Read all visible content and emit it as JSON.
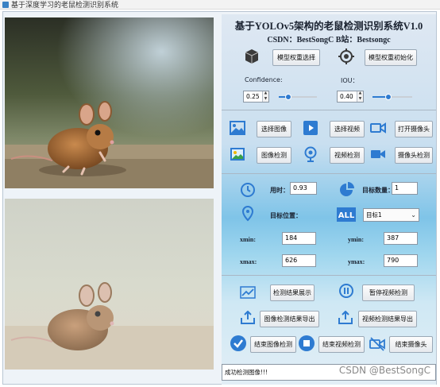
{
  "window": {
    "title": "基于深度学习的老鼠检测识别系统"
  },
  "header": {
    "system_title": "基于YOLOv5架构的老鼠检测识别系统V1.0",
    "csdn_line": "CSDN：BestSongC  B站：Bestsongc"
  },
  "model": {
    "select_label": "模型权重选择",
    "init_label": "模型权重初始化"
  },
  "params": {
    "confidence_label": "Confidence:",
    "confidence_value": "0.25",
    "confidence_level": 0.25,
    "iou_label": "IOU：",
    "iou_value": "0.40",
    "iou_level": 0.4
  },
  "actions": {
    "select_image": "选择图像",
    "select_video": "选择视频",
    "open_camera": "打开摄像头",
    "image_detect": "图像检测",
    "video_detect": "视频检测",
    "camera_detect": "摄像头检测"
  },
  "results": {
    "time_label": "用时：",
    "time_value": "0.93",
    "count_label": "目标数量：",
    "count_value": "1",
    "position_label": "目标位置：",
    "target_select": "目标1",
    "xmin_label": "xmin:",
    "xmin_value": "184",
    "ymin_label": "ymin:",
    "ymin_value": "387",
    "xmax_label": "xmax:",
    "xmax_value": "626",
    "ymax_label": "ymax:",
    "ymax_value": "790"
  },
  "controls": {
    "show_results": "检测结果展示",
    "pause_video": "暂停视频检测",
    "export_image": "图像检测结果导出",
    "export_video": "视频检测结果导出",
    "end_image": "结束图像检测",
    "end_video": "结束视频检测",
    "end_camera": "结束摄像头"
  },
  "status": {
    "message": "成功检测图像!!!"
  },
  "watermark": "CSDN @BestSongC",
  "colors": {
    "accent": "#2e7bd1",
    "icon_dark": "#2b2b2b"
  }
}
